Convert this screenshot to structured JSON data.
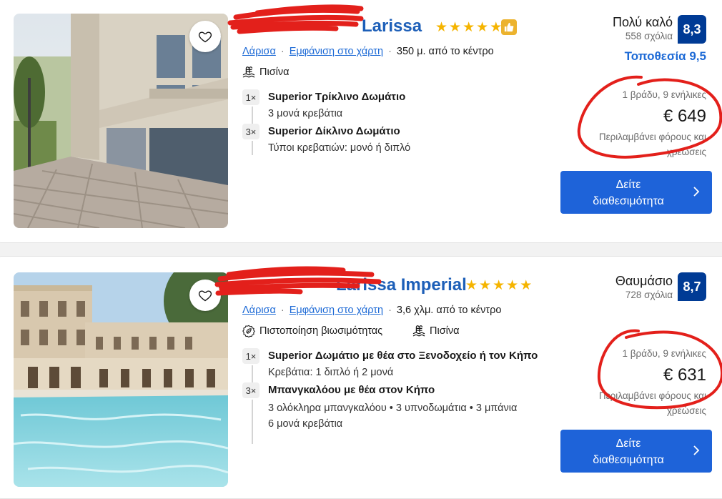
{
  "colors": {
    "link": "#1d6ad6",
    "title": "#1d5fb8",
    "score_badge": "#003b95",
    "cta": "#1e63d9",
    "star": "#f5b400",
    "annotation": "#e3201b"
  },
  "hotels": [
    {
      "title_visible": "Larissa",
      "title_obscured": true,
      "stars": 5,
      "preferred_badge_icon": "thumbs-up-icon",
      "location": {
        "city": "Λάρισα",
        "map_link": "Εμφάνιση στο χάρτη",
        "distance": "350 μ. από το κέντρο"
      },
      "amenities": [
        {
          "icon": "pool-icon",
          "label": "Πισίνα"
        }
      ],
      "rooms": [
        {
          "qty": "1×",
          "name": "Superior Τρίκλινο Δωμάτιο",
          "details": [
            "3 μονά κρεβάτια"
          ]
        },
        {
          "qty": "3×",
          "name": "Superior Δίκλινο Δωμάτιο",
          "details": [
            "Τύποι κρεβατιών: μονό ή διπλό"
          ]
        }
      ],
      "rating_word": "Πολύ καλό",
      "reviews": "558 σχόλια",
      "score": "8,3",
      "location_score": "Τοποθεσία 9,5",
      "nights": "1 βράδυ, 9 ενήλικες",
      "price": "€ 649",
      "taxes": "Περιλαμβάνει φόρους και χρεώσεις",
      "cta": [
        "Δείτε",
        "διαθεσιμότητα"
      ]
    },
    {
      "title_visible": "Larissa Imperial",
      "title_obscured": true,
      "stars": 5,
      "location": {
        "city": "Λάρισα",
        "map_link": "Εμφάνιση στο χάρτη",
        "distance": "3,6 χλμ. από το κέντρο"
      },
      "amenities": [
        {
          "icon": "sustainability-icon",
          "label": "Πιστοποίηση βιωσιμότητας"
        },
        {
          "icon": "pool-icon",
          "label": "Πισίνα"
        }
      ],
      "rooms": [
        {
          "qty": "1×",
          "name": "Superior Δωμάτιο με θέα στο Ξενοδοχείο ή τον Κήπο",
          "details": [
            "Κρεβάτια: 1 διπλό ή 2 μονά"
          ]
        },
        {
          "qty": "3×",
          "name": "Μπανγκαλόου με θέα στον Κήπο",
          "details": [
            "3 ολόκληρα μπανγκαλόου • 3 υπνοδωμάτια • 3 μπάνια",
            "6 μονά κρεβάτια"
          ]
        }
      ],
      "rating_word": "Θαυμάσιο",
      "reviews": "728 σχόλια",
      "score": "8,7",
      "nights": "1 βράδυ, 9 ενήλικες",
      "price": "€ 631",
      "taxes": "Περιλαμβάνει φόρους και χρεώσεις",
      "cta": [
        "Δείτε",
        "διαθεσιμότητα"
      ]
    }
  ]
}
